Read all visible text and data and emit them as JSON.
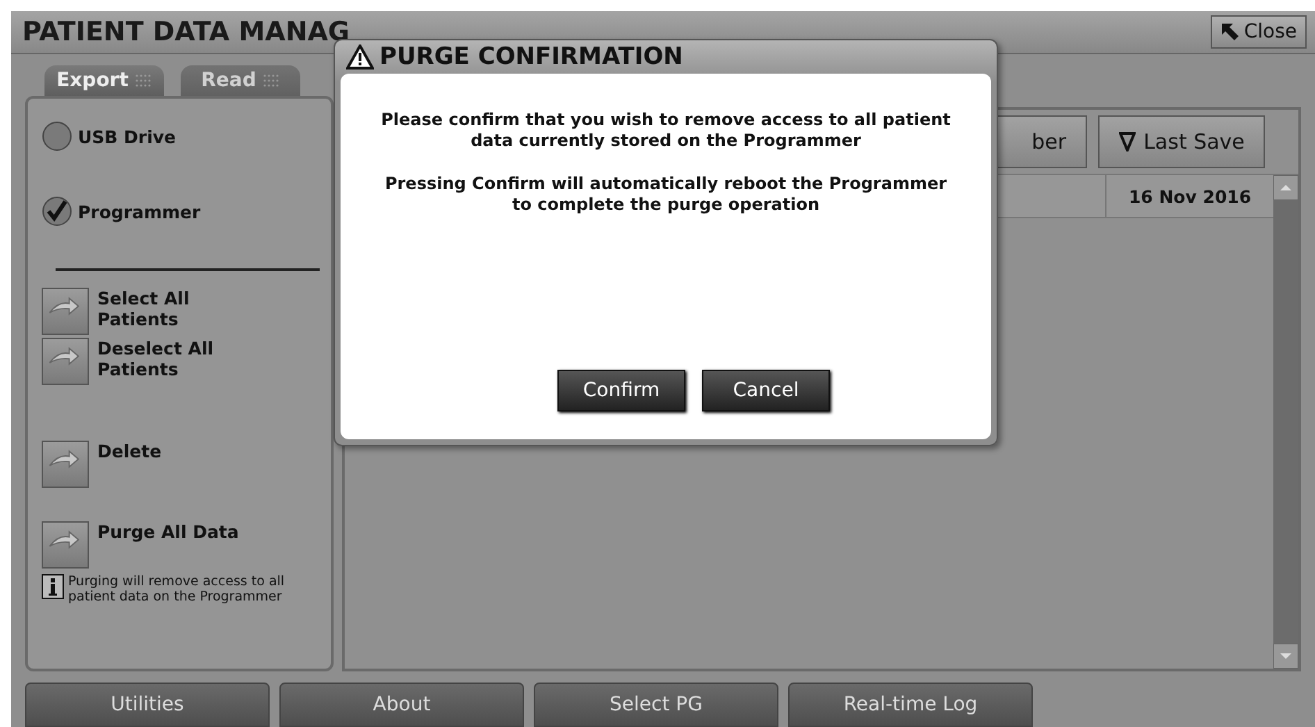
{
  "window": {
    "title": "PATIENT DATA MANAG",
    "close_button": "Close"
  },
  "tabs": [
    {
      "label": "Export",
      "selected": true
    },
    {
      "label": "Read",
      "selected": false
    }
  ],
  "sources": [
    {
      "label": "USB Drive",
      "selected": false
    },
    {
      "label": "Programmer",
      "selected": true
    }
  ],
  "actions": [
    "Select All Patients",
    "Deselect All Patients",
    "Delete",
    "Purge All Data"
  ],
  "info_note": "Purging will remove access to all patient data on the Programmer",
  "table": {
    "columns": [
      {
        "label": "ber",
        "sorted": false
      },
      {
        "label": "Last Save",
        "sorted": true
      }
    ],
    "rows": [
      {
        "last_save": "16 Nov 2016"
      }
    ]
  },
  "dialog": {
    "title": "PURGE CONFIRMATION",
    "messages": [
      "Please confirm that you wish to remove access to all patient data currently stored on the Programmer",
      "Pressing Confirm will automatically reboot the Programmer to complete the purge operation"
    ],
    "buttons": [
      "Confirm",
      "Cancel"
    ]
  },
  "nav": [
    "Utilities",
    "About",
    "Select PG",
    "Real-time Log"
  ]
}
